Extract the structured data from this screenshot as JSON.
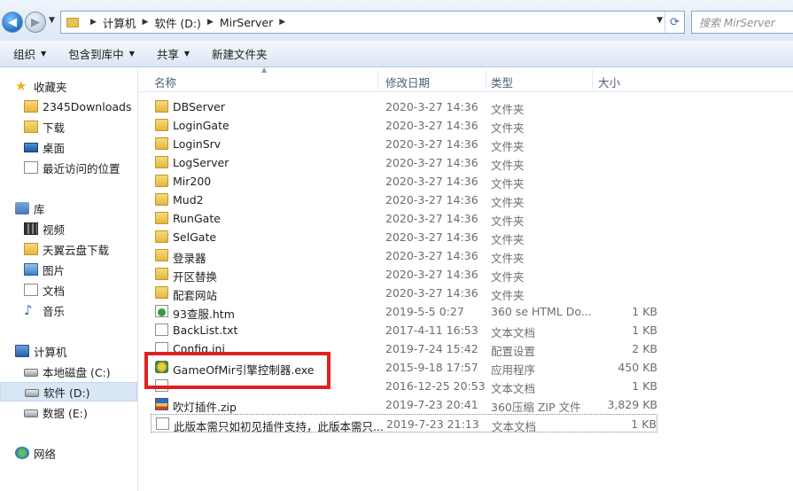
{
  "address": {
    "crumbs": [
      "计算机",
      "软件 (D:)",
      "MirServer"
    ],
    "search_placeholder": "搜索 MirServer"
  },
  "toolbar": {
    "organize": "组织",
    "include_library": "包含到库中",
    "share": "共享",
    "new_folder": "新建文件夹"
  },
  "nav": {
    "favorites": {
      "label": "收藏夹",
      "items": [
        "2345Downloads",
        "下载",
        "桌面",
        "最近访问的位置"
      ]
    },
    "libraries": {
      "label": "库",
      "items": [
        "视频",
        "天翼云盘下载",
        "图片",
        "文档",
        "音乐"
      ]
    },
    "computer": {
      "label": "计算机",
      "items": [
        "本地磁盘 (C:)",
        "软件 (D:)",
        "数据 (E:)"
      ]
    },
    "network": {
      "label": "网络"
    }
  },
  "columns": {
    "name": "名称",
    "date": "修改日期",
    "type": "类型",
    "size": "大小"
  },
  "files": [
    {
      "name": "DBServer",
      "date": "2020-3-27 14:36",
      "type": "文件夹",
      "size": "",
      "kind": "folder"
    },
    {
      "name": "LoginGate",
      "date": "2020-3-27 14:36",
      "type": "文件夹",
      "size": "",
      "kind": "folder"
    },
    {
      "name": "LoginSrv",
      "date": "2020-3-27 14:36",
      "type": "文件夹",
      "size": "",
      "kind": "folder"
    },
    {
      "name": "LogServer",
      "date": "2020-3-27 14:36",
      "type": "文件夹",
      "size": "",
      "kind": "folder"
    },
    {
      "name": "Mir200",
      "date": "2020-3-27 14:36",
      "type": "文件夹",
      "size": "",
      "kind": "folder"
    },
    {
      "name": "Mud2",
      "date": "2020-3-27 14:36",
      "type": "文件夹",
      "size": "",
      "kind": "folder"
    },
    {
      "name": "RunGate",
      "date": "2020-3-27 14:36",
      "type": "文件夹",
      "size": "",
      "kind": "folder"
    },
    {
      "name": "SelGate",
      "date": "2020-3-27 14:36",
      "type": "文件夹",
      "size": "",
      "kind": "folder"
    },
    {
      "name": "登录器",
      "date": "2020-3-27 14:36",
      "type": "文件夹",
      "size": "",
      "kind": "folder"
    },
    {
      "name": "开区替换",
      "date": "2020-3-27 14:36",
      "type": "文件夹",
      "size": "",
      "kind": "folder"
    },
    {
      "name": "配套网站",
      "date": "2020-3-27 14:36",
      "type": "文件夹",
      "size": "",
      "kind": "folder"
    },
    {
      "name": "93查服.htm",
      "date": "2019-5-5 0:27",
      "type": "360 se HTML Do...",
      "size": "1 KB",
      "kind": "htm"
    },
    {
      "name": "BackList.txt",
      "date": "2017-4-11 16:53",
      "type": "文本文档",
      "size": "1 KB",
      "kind": "doc"
    },
    {
      "name": "Config.ini",
      "date": "2019-7-24 15:42",
      "type": "配置设置",
      "size": "2 KB",
      "kind": "doc"
    },
    {
      "name": "GameOfMir引擎控制器.exe",
      "date": "2015-9-18 17:57",
      "type": "应用程序",
      "size": "450 KB",
      "kind": "exe"
    },
    {
      "name": "",
      "date": "2016-12-25 20:53",
      "type": "文本文档",
      "size": "1 KB",
      "kind": "doc"
    },
    {
      "name": "吹灯插件.zip",
      "date": "2019-7-23 20:41",
      "type": "360压缩 ZIP 文件",
      "size": "3,829 KB",
      "kind": "zip"
    },
    {
      "name": "此版本需只如初见插件支持，此版本需只...",
      "date": "2019-7-23 21:13",
      "type": "文本文档",
      "size": "1 KB",
      "kind": "doc"
    }
  ]
}
